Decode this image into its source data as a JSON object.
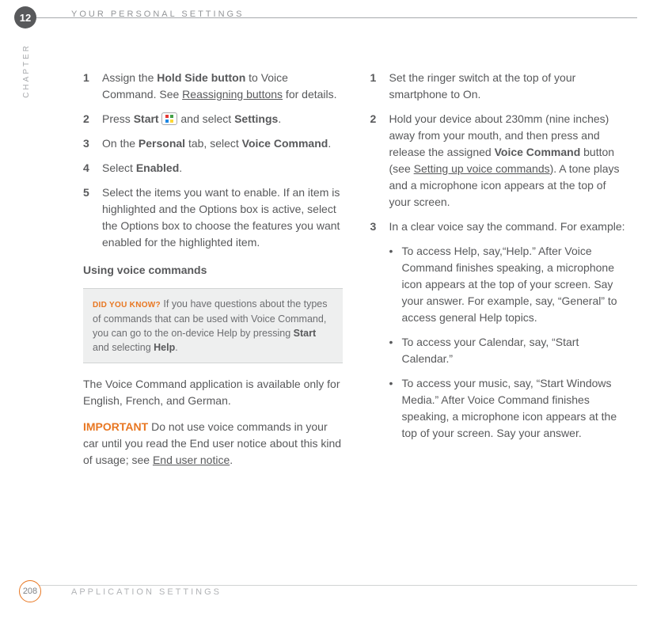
{
  "header": {
    "chapter_num": "12",
    "chapter_word": "CHAPTER",
    "title": "YOUR PERSONAL SETTINGS"
  },
  "left": {
    "s1": {
      "n": "1",
      "t1": "Assign the ",
      "b1": "Hold Side button",
      "t2": " to Voice Command. See ",
      "u1": "Reassigning buttons",
      "t3": " for details."
    },
    "s2": {
      "n": "2",
      "t1": "Press ",
      "b1": "Start",
      "t2": " and select ",
      "b2": "Settings",
      "t3": "."
    },
    "s3": {
      "n": "3",
      "t1": "On the ",
      "b1": "Personal",
      "t2": " tab, select ",
      "b2": "Voice Command",
      "t3": "."
    },
    "s4": {
      "n": "4",
      "t1": "Select ",
      "b1": "Enabled",
      "t2": "."
    },
    "s5": {
      "n": "5",
      "t1": "Select the items you want to enable. If an item is highlighted and the Options box is active, select the Options box to choose the features you want enabled for the highlighted item."
    },
    "subhead": "Using voice commands",
    "tip": {
      "lead": "DID YOU KNOW?",
      "t1": " If you have questions about the types of commands that can be used with Voice Command, you can go to the on-device Help by pressing ",
      "b1": "Start",
      "t2": " and selecting ",
      "b2": "Help",
      "t3": "."
    },
    "avail": "The Voice Command application is available only for English, French, and German.",
    "imp": {
      "lead": "IMPORTANT",
      "t1": "  Do not use voice commands in your car until you read the End user notice about this kind of usage; see ",
      "u1": "End user notice",
      "t2": "."
    }
  },
  "right": {
    "s1": {
      "n": "1",
      "t1": "Set the ringer switch at the top of your smartphone to On."
    },
    "s2": {
      "n": "2",
      "t1": "Hold your device about 230mm (nine inches) away from your mouth, and then press and release the assigned ",
      "b1": "Voice Command",
      "t2": " button (see ",
      "u1": "Setting up voice commands",
      "t3": "). A tone plays and a microphone icon appears at the top of your screen."
    },
    "s3": {
      "n": "3",
      "t1": "In a clear voice say the command. For example:"
    },
    "bul1": "To access Help, say,“Help.” After Voice Command finishes speaking, a microphone icon appears at the top of your screen. Say your answer. For example, say, “General” to access general Help topics.",
    "bul2": "To access your Calendar, say, “Start Calendar.”",
    "bul3": "To access your music, say, “Start Windows Media.” After Voice Command finishes speaking, a microphone icon appears at the top of your screen. Say your answer."
  },
  "footer": {
    "page": "208",
    "title": "APPLICATION SETTINGS"
  }
}
